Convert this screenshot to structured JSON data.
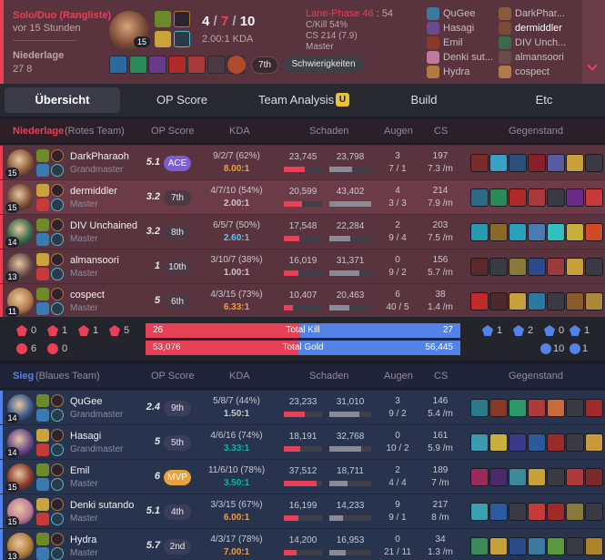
{
  "summary": {
    "queue": "Solo/Duo (Rangliste)",
    "time_ago": "vor 15 Stunden",
    "result": "Niederlage",
    "duration": "27 8",
    "champ_level": "15",
    "kda_k": "4",
    "kda_d": "7",
    "kda_a": "10",
    "kda_sep": "/",
    "kda_ratio": "2.00:1 KDA",
    "lane_label": "Lane-Phase 46",
    "lane_sep": ":",
    "lane_score": "54",
    "ckill": "C/Kill 54%",
    "cs": "CS 214 (7.9)",
    "rank": "Master",
    "position_badge": "7th",
    "difficulty_badge": "Schwierigkeiten",
    "participants_left": [
      "QuGee",
      "Hasagi",
      "Emil",
      "Denki sut...",
      "Hydra"
    ],
    "participants_right": [
      "DarkPhar...",
      "dermiddler",
      "DIV Unch...",
      "almansoori",
      "cospect"
    ]
  },
  "tabs": [
    "Übersicht",
    "OP Score",
    "Team Analysis",
    "Build",
    "Etc"
  ],
  "tab_badge": "U",
  "red_team": {
    "result": "Niederlage",
    "side": "(Rotes Team)",
    "headers": {
      "op": "OP Score",
      "kda": "KDA",
      "dmg": "Schaden",
      "aug": "Augen",
      "cs": "CS",
      "items": "Gegenstand"
    },
    "players": [
      {
        "name": "DarkPharaoh",
        "rank": "Grandmaster",
        "level": "15",
        "score": "5.1",
        "badge": "ACE",
        "kda": "9/2/7 (62%)",
        "ratio": "8.00:1",
        "dmg_dealt": "23,745",
        "dmg_taken": "23,798",
        "dealt_frac": 0.55,
        "taken_frac": 0.55,
        "aug": "3",
        "aug2": "7 / 1",
        "cs": "197",
        "cs2": "7.3 /m"
      },
      {
        "name": "dermiddler",
        "rank": "Master",
        "level": "15",
        "score": "3.2",
        "badge": "7th",
        "kda": "4/7/10 (54%)",
        "ratio": "2.00:1",
        "dmg_dealt": "20,599",
        "dmg_taken": "43,402",
        "dealt_frac": 0.48,
        "taken_frac": 1.0,
        "aug": "4",
        "aug2": "3 / 3",
        "cs": "214",
        "cs2": "7.9 /m"
      },
      {
        "name": "DIV Unchained",
        "rank": "Master",
        "level": "14",
        "score": "3.2",
        "badge": "8th",
        "kda": "6/5/7 (50%)",
        "ratio": "2.60:1",
        "dmg_dealt": "17,548",
        "dmg_taken": "22,284",
        "dealt_frac": 0.41,
        "taken_frac": 0.51,
        "aug": "2",
        "aug2": "9 / 4",
        "cs": "203",
        "cs2": "7.5 /m"
      },
      {
        "name": "almansoori",
        "rank": "Master",
        "level": "13",
        "score": "1",
        "badge": "10th",
        "kda": "3/10/7 (38%)",
        "ratio": "1.00:1",
        "dmg_dealt": "16,019",
        "dmg_taken": "31,371",
        "dealt_frac": 0.37,
        "taken_frac": 0.72,
        "aug": "0",
        "aug2": "9 / 2",
        "cs": "156",
        "cs2": "5.7 /m"
      },
      {
        "name": "cospect",
        "rank": "Master",
        "level": "11",
        "score": "5",
        "badge": "6th",
        "kda": "4/3/15 (73%)",
        "ratio": "6.33:1",
        "dmg_dealt": "10,407",
        "dmg_taken": "20,463",
        "dealt_frac": 0.24,
        "taken_frac": 0.47,
        "aug": "6",
        "aug2": "40 / 5",
        "cs": "38",
        "cs2": "1.4 /m"
      }
    ]
  },
  "objectives": {
    "left_row1": [
      "0",
      "1",
      "1",
      "5"
    ],
    "left_row2": [
      "6",
      "0"
    ],
    "total_kill_label": "Total Kill",
    "total_gold_label": "Total Gold",
    "kill_red": "26",
    "kill_blue": "27",
    "gold_red": "53,076",
    "gold_blue": "56,445",
    "kill_red_frac": 0.49,
    "gold_red_frac": 0.485,
    "right_row1": [
      "1",
      "2",
      "0",
      "1"
    ],
    "right_row2": [
      "10",
      "1"
    ]
  },
  "blue_team": {
    "result": "Sieg",
    "side": "(Blaues Team)",
    "headers": {
      "op": "OP Score",
      "kda": "KDA",
      "dmg": "Schaden",
      "aug": "Augen",
      "cs": "CS",
      "items": "Gegenstand"
    },
    "players": [
      {
        "name": "QuGee",
        "rank": "Grandmaster",
        "level": "14",
        "score": "2.4",
        "badge": "9th",
        "kda": "5/8/7 (44%)",
        "ratio": "1.50:1",
        "dmg_dealt": "23,233",
        "dmg_taken": "31,010",
        "dealt_frac": 0.54,
        "taken_frac": 0.71,
        "aug": "3",
        "aug2": "9 / 2",
        "cs": "146",
        "cs2": "5.4 /m"
      },
      {
        "name": "Hasagi",
        "rank": "Grandmaster",
        "level": "14",
        "score": "5",
        "badge": "5th",
        "kda": "4/6/16 (74%)",
        "ratio": "3.33:1",
        "dmg_dealt": "18,191",
        "dmg_taken": "32,768",
        "dealt_frac": 0.42,
        "taken_frac": 0.75,
        "aug": "0",
        "aug2": "10 / 2",
        "cs": "161",
        "cs2": "5.9 /m"
      },
      {
        "name": "Emil",
        "rank": "Master",
        "level": "15",
        "score": "6",
        "badge": "MVP",
        "kda": "11/6/10 (78%)",
        "ratio": "3.50:1",
        "dmg_dealt": "37,512",
        "dmg_taken": "18,711",
        "dealt_frac": 0.86,
        "taken_frac": 0.43,
        "aug": "2",
        "aug2": "4 / 4",
        "cs": "189",
        "cs2": "7 /m"
      },
      {
        "name": "Denki sutando",
        "rank": "Master",
        "level": "15",
        "score": "5.1",
        "badge": "4th",
        "kda": "3/3/15 (67%)",
        "ratio": "6.00:1",
        "dmg_dealt": "16,199",
        "dmg_taken": "14,233",
        "dealt_frac": 0.37,
        "taken_frac": 0.33,
        "aug": "9",
        "aug2": "9 / 1",
        "cs": "217",
        "cs2": "8 /m"
      },
      {
        "name": "Hydra",
        "rank": "Master",
        "level": "13",
        "score": "5.7",
        "badge": "2nd",
        "kda": "4/3/17 (78%)",
        "ratio": "7.00:1",
        "dmg_dealt": "14,200",
        "dmg_taken": "16,953",
        "dealt_frac": 0.33,
        "taken_frac": 0.39,
        "aug": "0",
        "aug2": "21 / 11",
        "cs": "34",
        "cs2": "1.3 /m"
      }
    ]
  },
  "colors": {
    "red": "#e84057",
    "blue": "#5383e8",
    "gold": "#f19e3f",
    "teal": "#00bba3",
    "purple": "#7b5ecf",
    "mvp": "#e9a13a"
  }
}
